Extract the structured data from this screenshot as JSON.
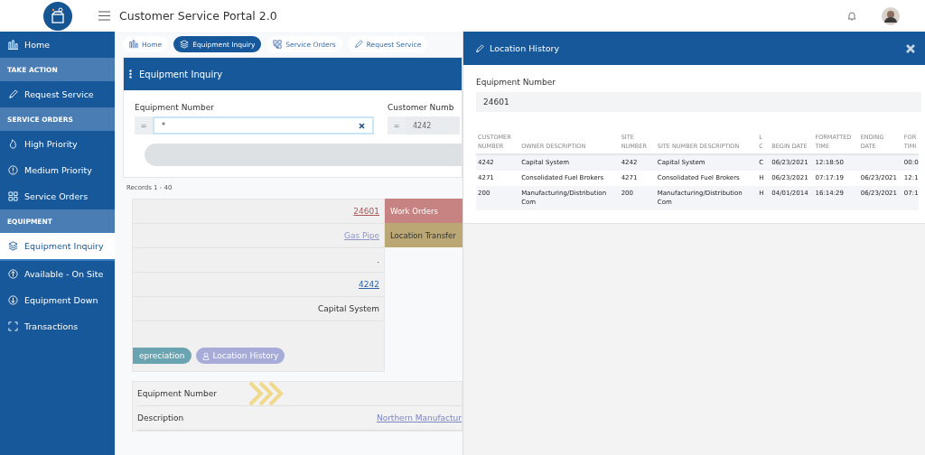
{
  "header": {
    "title": "Customer Service Portal 2.0"
  },
  "sidebar": {
    "items": [
      {
        "kind": "item",
        "label": "Home",
        "selected": false
      },
      {
        "kind": "section",
        "label": "TAKE ACTION"
      },
      {
        "kind": "item",
        "label": "Request Service",
        "selected": false
      },
      {
        "kind": "section",
        "label": "SERVICE ORDERS"
      },
      {
        "kind": "item",
        "label": "High Priority",
        "selected": false
      },
      {
        "kind": "item",
        "label": "Medium Priority",
        "selected": false
      },
      {
        "kind": "item",
        "label": "Service Orders",
        "selected": false
      },
      {
        "kind": "section",
        "label": "EQUIPMENT"
      },
      {
        "kind": "item",
        "label": "Equipment Inquiry",
        "selected": true
      },
      {
        "kind": "item",
        "label": "Available - On Site",
        "selected": false
      },
      {
        "kind": "item",
        "label": "Equipment Down",
        "selected": false
      },
      {
        "kind": "item",
        "label": "Transactions",
        "selected": false
      }
    ]
  },
  "tabs": [
    {
      "label": "Home",
      "selected": false
    },
    {
      "label": "Equipment Inquiry",
      "selected": true
    },
    {
      "label": "Service Orders",
      "selected": false
    },
    {
      "label": "Request Service",
      "selected": false
    }
  ],
  "inquiry": {
    "title": "Equipment Inquiry",
    "fields": [
      {
        "label": "Equipment Number",
        "operator": "=",
        "value": "*"
      },
      {
        "label": "Customer Numb",
        "operator": "=",
        "value": "4242"
      }
    ],
    "records": "Records  1 - 40",
    "detail_values": [
      {
        "text": "24601",
        "kind": "link-red"
      },
      {
        "text": "Gas Pipe",
        "kind": "link"
      },
      {
        "text": ".",
        "kind": "plain"
      },
      {
        "text": "4242",
        "kind": "link-blue"
      },
      {
        "text": "Capital System",
        "kind": "plain"
      }
    ],
    "card_buttons": [
      {
        "label": "epreciation",
        "color": "#6ba4b1"
      },
      {
        "label": "Location History",
        "color": "#a7abd8"
      }
    ],
    "side_buttons": [
      {
        "label": "Work Orders",
        "color": "#c78282"
      },
      {
        "label": "Location Transfer",
        "color": "#bba774"
      }
    ],
    "lower_rows": [
      {
        "label": "Equipment Number"
      },
      {
        "label": "Description",
        "value": "Northern Manufactur"
      }
    ]
  },
  "location_history": {
    "title": "Location History",
    "field_label": "Equipment Number",
    "field_value": "24601",
    "columns": [
      "CUSTOMER NUMBER",
      "OWNER DESCRIPTION",
      "SITE NUMBER",
      "SITE NUMBER DESCRIPTION",
      "L C",
      "BEGIN DATE",
      "FORMATTED TIME",
      "ENDING DATE",
      "FOR TIMI"
    ],
    "rows": [
      [
        "4242",
        "Capital System",
        "4242",
        "Capital System",
        "C",
        "06/23/2021",
        "12:18:50",
        "",
        "00:0"
      ],
      [
        "4271",
        "Consolidated Fuel Brokers",
        "4271",
        "Consolidated Fuel Brokers",
        "H",
        "06/23/2021",
        "07:17:19",
        "06/23/2021",
        "12:1"
      ],
      [
        "200",
        "Manufacturing/Distribution Com",
        "200",
        "Manufacturing/Distribution Com",
        "H",
        "04/01/2014",
        "16:14:29",
        "06/23/2021",
        "07:1"
      ]
    ]
  }
}
